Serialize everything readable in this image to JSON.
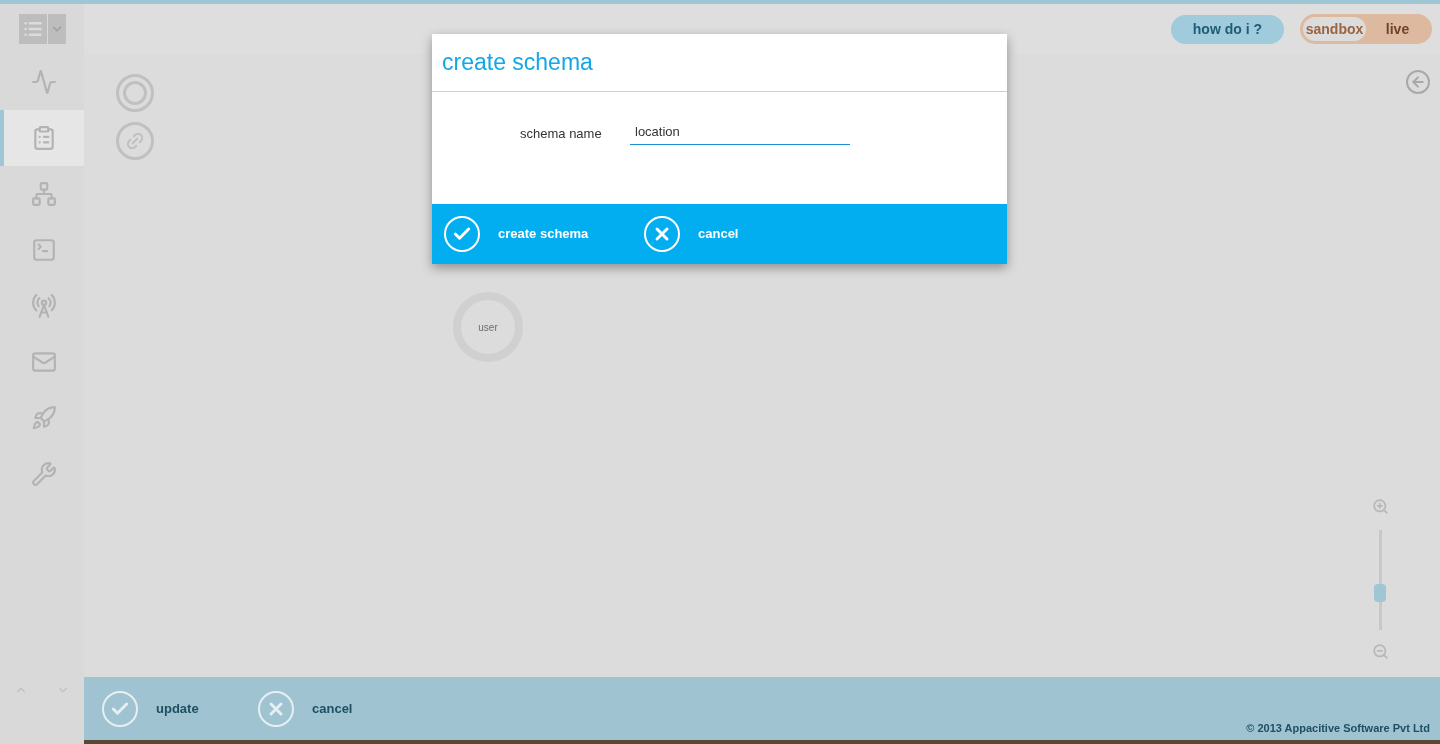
{
  "sidebar": {
    "items": [
      {
        "kind": "activity",
        "selected": false
      },
      {
        "kind": "schema",
        "selected": true
      },
      {
        "kind": "hierarchy",
        "selected": false
      },
      {
        "kind": "terminal",
        "selected": false
      },
      {
        "kind": "broadcast",
        "selected": false
      },
      {
        "kind": "mail",
        "selected": false
      },
      {
        "kind": "rocket",
        "selected": false
      },
      {
        "kind": "tools",
        "selected": false
      }
    ]
  },
  "header": {
    "help_button": "how do i ?",
    "environment": [
      {
        "label": "sandbox",
        "selected": true
      },
      {
        "label": "live",
        "selected": false
      }
    ]
  },
  "canvas": {
    "nodes": [
      {
        "label": "user"
      }
    ],
    "zoom": {
      "level": 0.37
    }
  },
  "footer": {
    "actions": [
      {
        "kind": "confirm",
        "label": "update"
      },
      {
        "kind": "cancel",
        "label": "cancel"
      }
    ],
    "copyright": "© 2013 Appacitive Software Pvt Ltd"
  },
  "dialog": {
    "title": "create schema",
    "field": {
      "label": "schema name",
      "value": "location"
    },
    "actions": [
      {
        "kind": "confirm",
        "label": "create schema"
      },
      {
        "kind": "cancel",
        "label": "cancel"
      }
    ]
  }
}
